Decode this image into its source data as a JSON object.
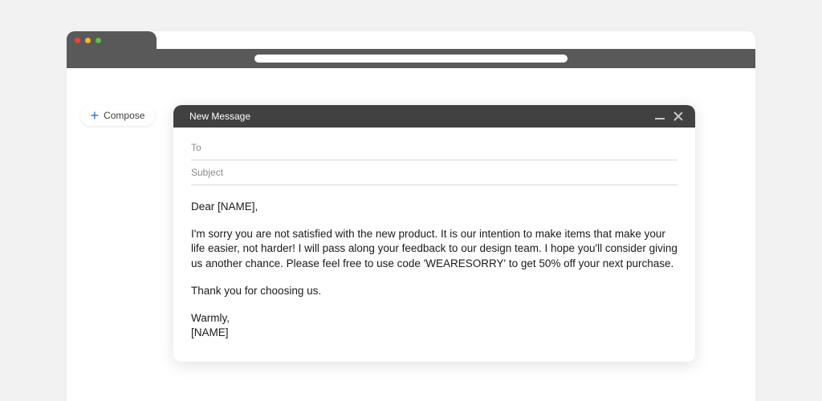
{
  "compose": {
    "label": "Compose"
  },
  "message": {
    "title": "New Message",
    "to_label": "To",
    "subject_label": "Subject",
    "body": {
      "greeting": "Dear [NAME],",
      "paragraph1": "I'm sorry you are not satisfied with the new product. It is our intention to make items that make your life easier, not harder! I will pass along your feedback to our design team. I hope you'll consider giving us another chance. Please feel free to use code 'WEARESORRY' to get 50% off your next purchase.",
      "paragraph2": "Thank you for choosing us.",
      "signoff": "Warmly,",
      "signature": "[NAME]"
    }
  }
}
